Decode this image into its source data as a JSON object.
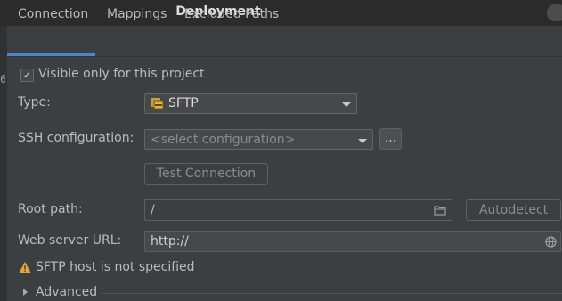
{
  "dialog": {
    "title": "Deployment"
  },
  "left_edge": {
    "digit": "6"
  },
  "tabs": [
    {
      "label": "Connection",
      "active": true
    },
    {
      "label": "Mappings",
      "active": false
    },
    {
      "label": "Excluded Paths",
      "active": false
    }
  ],
  "visible_only": {
    "label": "Visible only for this project",
    "checked": true
  },
  "type": {
    "label": "Type:",
    "value": "SFTP",
    "icon": "sftp-icon"
  },
  "ssh": {
    "label": "SSH configuration:",
    "placeholder": "<select configuration>",
    "browse_label": "..."
  },
  "test_connection": {
    "label": "Test Connection"
  },
  "root_path": {
    "label": "Root path:",
    "value": "/",
    "autodetect_label": "Autodetect"
  },
  "web_server": {
    "label": "Web server URL:",
    "value": "http://"
  },
  "warning": {
    "text": "SFTP host is not specified",
    "color": "#e6a23c"
  },
  "advanced": {
    "label": "Advanced"
  },
  "colors": {
    "accent": "#4a88c7",
    "background": "#3c3f41",
    "titlebar": "#2b2b2b"
  }
}
